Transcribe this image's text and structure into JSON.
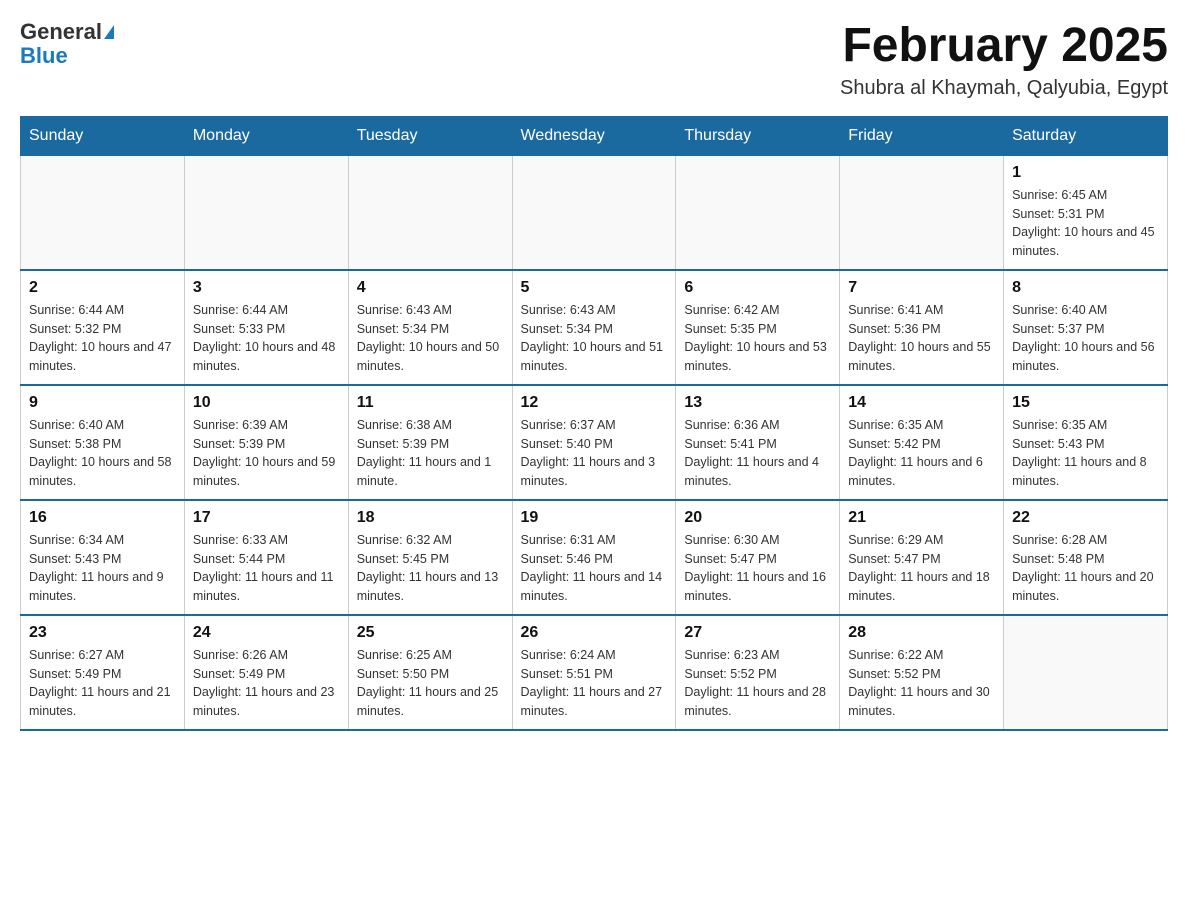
{
  "header": {
    "logo_general": "General",
    "logo_blue": "Blue",
    "title": "February 2025",
    "subtitle": "Shubra al Khaymah, Qalyubia, Egypt"
  },
  "weekdays": [
    "Sunday",
    "Monday",
    "Tuesday",
    "Wednesday",
    "Thursday",
    "Friday",
    "Saturday"
  ],
  "weeks": [
    [
      {
        "day": "",
        "info": ""
      },
      {
        "day": "",
        "info": ""
      },
      {
        "day": "",
        "info": ""
      },
      {
        "day": "",
        "info": ""
      },
      {
        "day": "",
        "info": ""
      },
      {
        "day": "",
        "info": ""
      },
      {
        "day": "1",
        "info": "Sunrise: 6:45 AM\nSunset: 5:31 PM\nDaylight: 10 hours and 45 minutes."
      }
    ],
    [
      {
        "day": "2",
        "info": "Sunrise: 6:44 AM\nSunset: 5:32 PM\nDaylight: 10 hours and 47 minutes."
      },
      {
        "day": "3",
        "info": "Sunrise: 6:44 AM\nSunset: 5:33 PM\nDaylight: 10 hours and 48 minutes."
      },
      {
        "day": "4",
        "info": "Sunrise: 6:43 AM\nSunset: 5:34 PM\nDaylight: 10 hours and 50 minutes."
      },
      {
        "day": "5",
        "info": "Sunrise: 6:43 AM\nSunset: 5:34 PM\nDaylight: 10 hours and 51 minutes."
      },
      {
        "day": "6",
        "info": "Sunrise: 6:42 AM\nSunset: 5:35 PM\nDaylight: 10 hours and 53 minutes."
      },
      {
        "day": "7",
        "info": "Sunrise: 6:41 AM\nSunset: 5:36 PM\nDaylight: 10 hours and 55 minutes."
      },
      {
        "day": "8",
        "info": "Sunrise: 6:40 AM\nSunset: 5:37 PM\nDaylight: 10 hours and 56 minutes."
      }
    ],
    [
      {
        "day": "9",
        "info": "Sunrise: 6:40 AM\nSunset: 5:38 PM\nDaylight: 10 hours and 58 minutes."
      },
      {
        "day": "10",
        "info": "Sunrise: 6:39 AM\nSunset: 5:39 PM\nDaylight: 10 hours and 59 minutes."
      },
      {
        "day": "11",
        "info": "Sunrise: 6:38 AM\nSunset: 5:39 PM\nDaylight: 11 hours and 1 minute."
      },
      {
        "day": "12",
        "info": "Sunrise: 6:37 AM\nSunset: 5:40 PM\nDaylight: 11 hours and 3 minutes."
      },
      {
        "day": "13",
        "info": "Sunrise: 6:36 AM\nSunset: 5:41 PM\nDaylight: 11 hours and 4 minutes."
      },
      {
        "day": "14",
        "info": "Sunrise: 6:35 AM\nSunset: 5:42 PM\nDaylight: 11 hours and 6 minutes."
      },
      {
        "day": "15",
        "info": "Sunrise: 6:35 AM\nSunset: 5:43 PM\nDaylight: 11 hours and 8 minutes."
      }
    ],
    [
      {
        "day": "16",
        "info": "Sunrise: 6:34 AM\nSunset: 5:43 PM\nDaylight: 11 hours and 9 minutes."
      },
      {
        "day": "17",
        "info": "Sunrise: 6:33 AM\nSunset: 5:44 PM\nDaylight: 11 hours and 11 minutes."
      },
      {
        "day": "18",
        "info": "Sunrise: 6:32 AM\nSunset: 5:45 PM\nDaylight: 11 hours and 13 minutes."
      },
      {
        "day": "19",
        "info": "Sunrise: 6:31 AM\nSunset: 5:46 PM\nDaylight: 11 hours and 14 minutes."
      },
      {
        "day": "20",
        "info": "Sunrise: 6:30 AM\nSunset: 5:47 PM\nDaylight: 11 hours and 16 minutes."
      },
      {
        "day": "21",
        "info": "Sunrise: 6:29 AM\nSunset: 5:47 PM\nDaylight: 11 hours and 18 minutes."
      },
      {
        "day": "22",
        "info": "Sunrise: 6:28 AM\nSunset: 5:48 PM\nDaylight: 11 hours and 20 minutes."
      }
    ],
    [
      {
        "day": "23",
        "info": "Sunrise: 6:27 AM\nSunset: 5:49 PM\nDaylight: 11 hours and 21 minutes."
      },
      {
        "day": "24",
        "info": "Sunrise: 6:26 AM\nSunset: 5:49 PM\nDaylight: 11 hours and 23 minutes."
      },
      {
        "day": "25",
        "info": "Sunrise: 6:25 AM\nSunset: 5:50 PM\nDaylight: 11 hours and 25 minutes."
      },
      {
        "day": "26",
        "info": "Sunrise: 6:24 AM\nSunset: 5:51 PM\nDaylight: 11 hours and 27 minutes."
      },
      {
        "day": "27",
        "info": "Sunrise: 6:23 AM\nSunset: 5:52 PM\nDaylight: 11 hours and 28 minutes."
      },
      {
        "day": "28",
        "info": "Sunrise: 6:22 AM\nSunset: 5:52 PM\nDaylight: 11 hours and 30 minutes."
      },
      {
        "day": "",
        "info": ""
      }
    ]
  ]
}
